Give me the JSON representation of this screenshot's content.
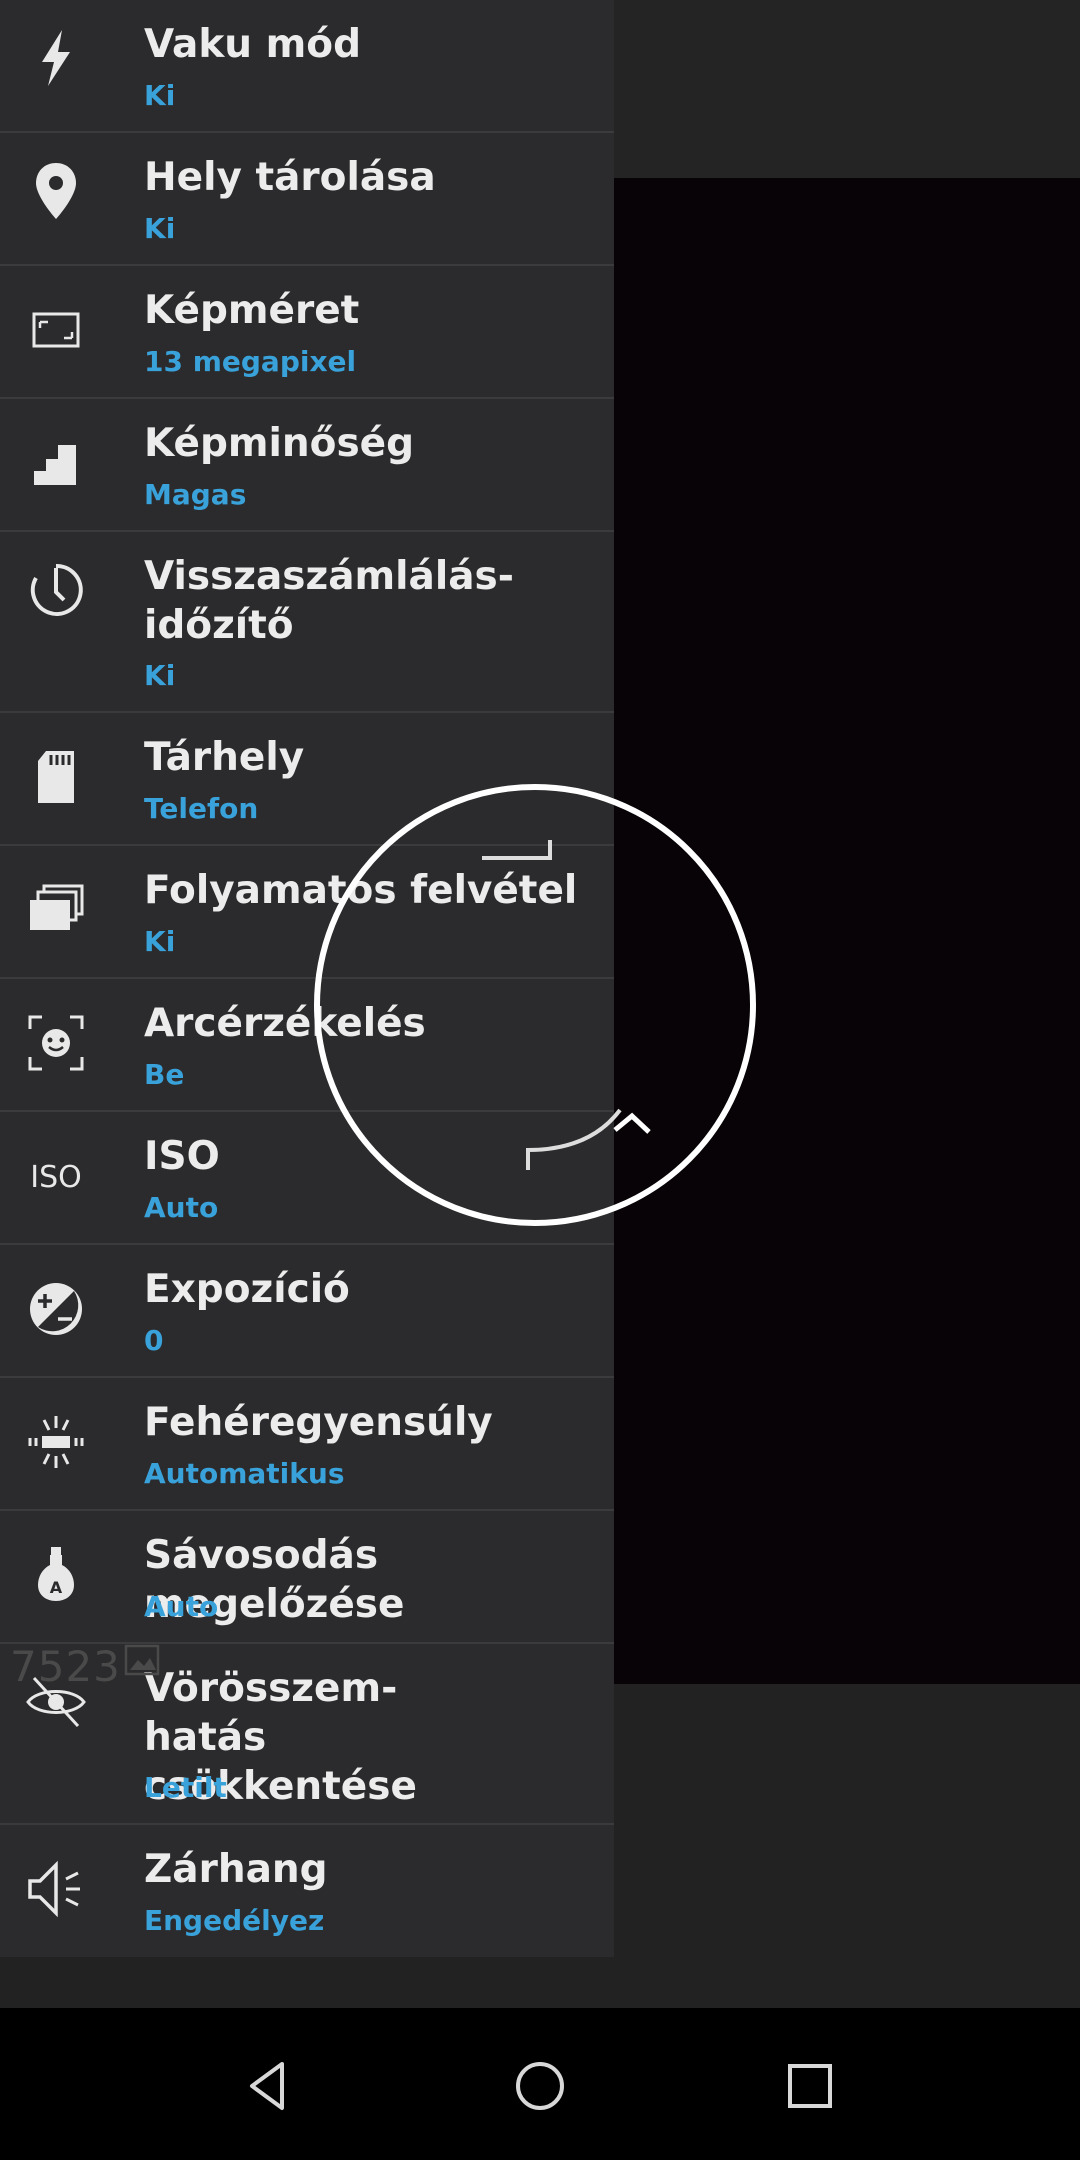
{
  "settings": [
    {
      "icon": "flash-icon",
      "title": "Vaku mód",
      "value": "Ki"
    },
    {
      "icon": "location-pin-icon",
      "title": "Hely tárolása",
      "value": "Ki"
    },
    {
      "icon": "picture-size-icon",
      "title": "Képméret",
      "value": "13 megapixel"
    },
    {
      "icon": "quality-steps-icon",
      "title": "Képminőség",
      "value": "Magas"
    },
    {
      "icon": "countdown-timer-icon",
      "title": "Visszaszámlálás-időzítő",
      "value": "Ki"
    },
    {
      "icon": "sd-card-icon",
      "title": "Tárhely",
      "value": "Telefon"
    },
    {
      "icon": "continuous-shot-icon",
      "title": "Folyamatos felvétel",
      "value": "Ki"
    },
    {
      "icon": "face-detection-icon",
      "title": "Arcérzékelés",
      "value": "Be"
    },
    {
      "icon": "iso-icon",
      "title": "ISO",
      "value": "Auto"
    },
    {
      "icon": "exposure-icon",
      "title": "Expozíció",
      "value": "0"
    },
    {
      "icon": "white-balance-icon",
      "title": "Fehéregyensúly",
      "value": "Automatikus"
    },
    {
      "icon": "antibanding-bulb-icon",
      "title": "Sávosodás megelőzése",
      "value": "Auto"
    },
    {
      "icon": "red-eye-icon",
      "title": "Vörösszem-hatás csökkentése",
      "value": "Letilt"
    },
    {
      "icon": "shutter-sound-icon",
      "title": "Zárhang",
      "value": "Engedélyez"
    }
  ],
  "iso_icon_text": "ISO",
  "watermark": "7523",
  "colors": {
    "accent": "#3aa2da",
    "drawer": "#2b2b2d",
    "preview": "#070306"
  },
  "navbar": {
    "back": "back-icon",
    "home": "home-icon",
    "recents": "recents-icon"
  }
}
